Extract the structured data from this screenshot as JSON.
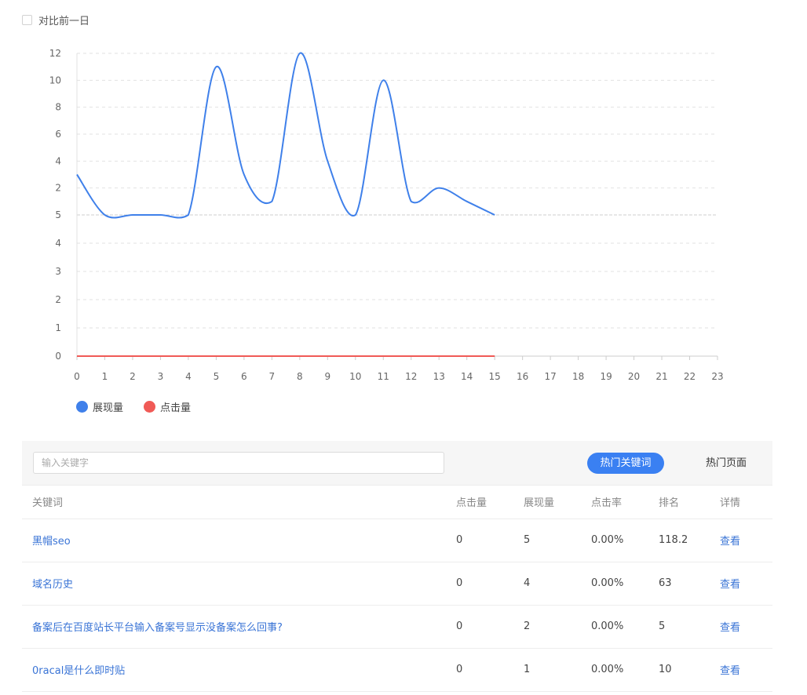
{
  "compare": {
    "label": "对比前一日"
  },
  "chart_data": {
    "type": "line",
    "x": [
      0,
      1,
      2,
      3,
      4,
      5,
      6,
      7,
      8,
      9,
      10,
      11,
      12,
      13,
      14,
      15
    ],
    "x_ticks": [
      "0",
      "1",
      "2",
      "3",
      "4",
      "5",
      "6",
      "7",
      "8",
      "9",
      "10",
      "11",
      "12",
      "13",
      "14",
      "15",
      "16",
      "17",
      "18",
      "19",
      "20",
      "21",
      "22",
      "23"
    ],
    "y_ticks_upper": [
      "12",
      "10",
      "8",
      "6",
      "4",
      "2",
      "5"
    ],
    "y_ticks_lower": [
      "4",
      "3",
      "2",
      "1",
      "0"
    ],
    "xlim": [
      0,
      23
    ],
    "grid": true,
    "legend_position": "bottom-left",
    "series": [
      {
        "name": "展现量",
        "color": "#3f80ea",
        "values": [
          3,
          0,
          0,
          0,
          0,
          11,
          3,
          1,
          12,
          4,
          0,
          10,
          1,
          2,
          1,
          0
        ]
      },
      {
        "name": "点击量",
        "color": "#f05a56",
        "values": [
          0,
          0,
          0,
          0,
          0,
          0,
          0,
          0,
          0,
          0,
          0,
          0,
          0,
          0,
          0,
          0
        ]
      }
    ]
  },
  "legend": [
    {
      "label": "展现量",
      "color": "#3f80ea"
    },
    {
      "label": "点击量",
      "color": "#f05a56"
    }
  ],
  "toolbar": {
    "search_placeholder": "输入关键字",
    "tab_keywords": "热门关键词",
    "tab_pages": "热门页面"
  },
  "table": {
    "headers": {
      "keyword": "关键词",
      "clicks": "点击量",
      "impressions": "展现量",
      "ctr": "点击率",
      "rank": "排名",
      "detail": "详情"
    },
    "rows": [
      {
        "keyword": "黑帽seo",
        "clicks": "0",
        "impressions": "5",
        "ctr": "0.00%",
        "rank": "118.2",
        "detail": "查看"
      },
      {
        "keyword": "域名历史",
        "clicks": "0",
        "impressions": "4",
        "ctr": "0.00%",
        "rank": "63",
        "detail": "查看"
      },
      {
        "keyword": "备案后在百度站长平台输入备案号显示没备案怎么回事?",
        "clicks": "0",
        "impressions": "2",
        "ctr": "0.00%",
        "rank": "5",
        "detail": "查看"
      },
      {
        "keyword": "0racal是什么即时贴",
        "clicks": "0",
        "impressions": "1",
        "ctr": "0.00%",
        "rank": "10",
        "detail": "查看"
      }
    ]
  }
}
